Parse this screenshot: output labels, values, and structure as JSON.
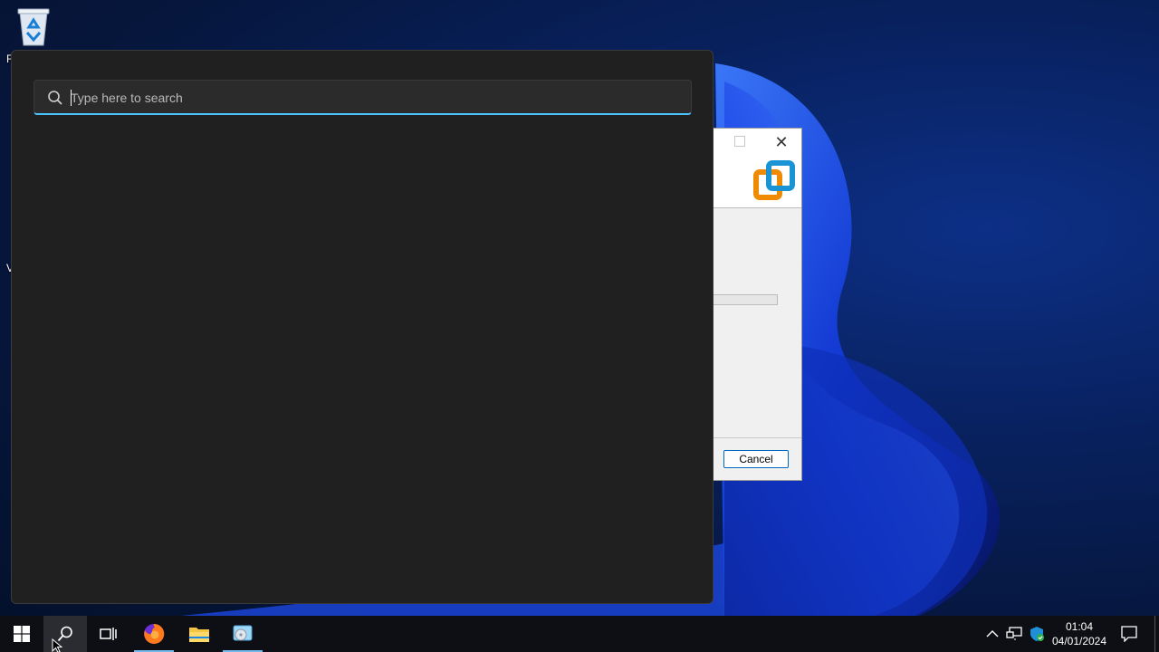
{
  "desktop": {
    "icons": [
      {
        "name": "Recycle Bin",
        "label": "R"
      },
      {
        "name": "V",
        "label": "V"
      }
    ]
  },
  "search": {
    "placeholder": "Type here to search",
    "value": ""
  },
  "installer_dialog": {
    "cancel_label": "Cancel"
  },
  "taskbar": {
    "items": [
      {
        "name": "start",
        "icon": "windows-logo-icon"
      },
      {
        "name": "search",
        "icon": "search-icon",
        "active": true
      },
      {
        "name": "task-view",
        "icon": "task-view-icon"
      },
      {
        "name": "firefox",
        "icon": "firefox-icon",
        "running": true
      },
      {
        "name": "file-explorer",
        "icon": "folder-icon"
      },
      {
        "name": "installer",
        "icon": "installer-disc-icon",
        "running": true
      }
    ],
    "tray": {
      "time": "01:04",
      "date": "04/01/2024"
    }
  },
  "colors": {
    "accent": "#4cc2ff",
    "panel": "#202020",
    "taskbar": "#0d0f14"
  }
}
